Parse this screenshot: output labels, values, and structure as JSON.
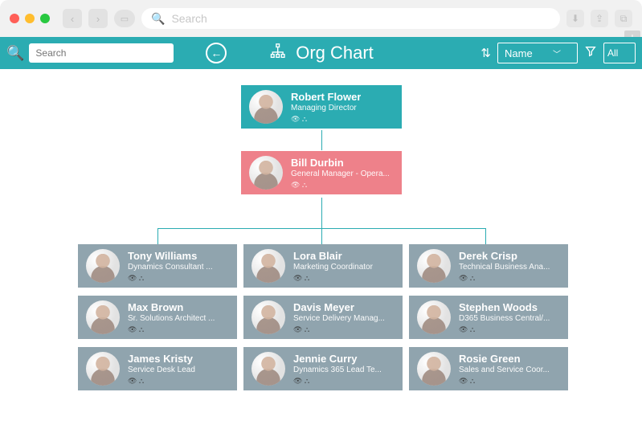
{
  "browser": {
    "search_placeholder": "Search"
  },
  "appbar": {
    "search_placeholder": "Search",
    "title": "Org Chart",
    "sort_label": "Name",
    "filter_label": "All"
  },
  "org": {
    "root": {
      "name": "Robert Flower",
      "title": "Managing Director"
    },
    "mid": {
      "name": "Bill Durbin",
      "title": "General Manager - Opera..."
    },
    "grid": [
      {
        "name": "Tony Williams",
        "title": "Dynamics Consultant ..."
      },
      {
        "name": "Lora Blair",
        "title": "Marketing Coordinator"
      },
      {
        "name": "Derek Crisp",
        "title": "Technical Business Ana..."
      },
      {
        "name": "Max Brown",
        "title": "Sr. Solutions Architect ..."
      },
      {
        "name": "Davis Meyer",
        "title": "Service Delivery Manag..."
      },
      {
        "name": "Stephen Woods",
        "title": "D365 Business Central/..."
      },
      {
        "name": "James Kristy",
        "title": "Service Desk Lead"
      },
      {
        "name": "Jennie Curry",
        "title": "Dynamics 365 Lead Te..."
      },
      {
        "name": "Rosie Green",
        "title": "Sales and Service Coor..."
      }
    ]
  }
}
